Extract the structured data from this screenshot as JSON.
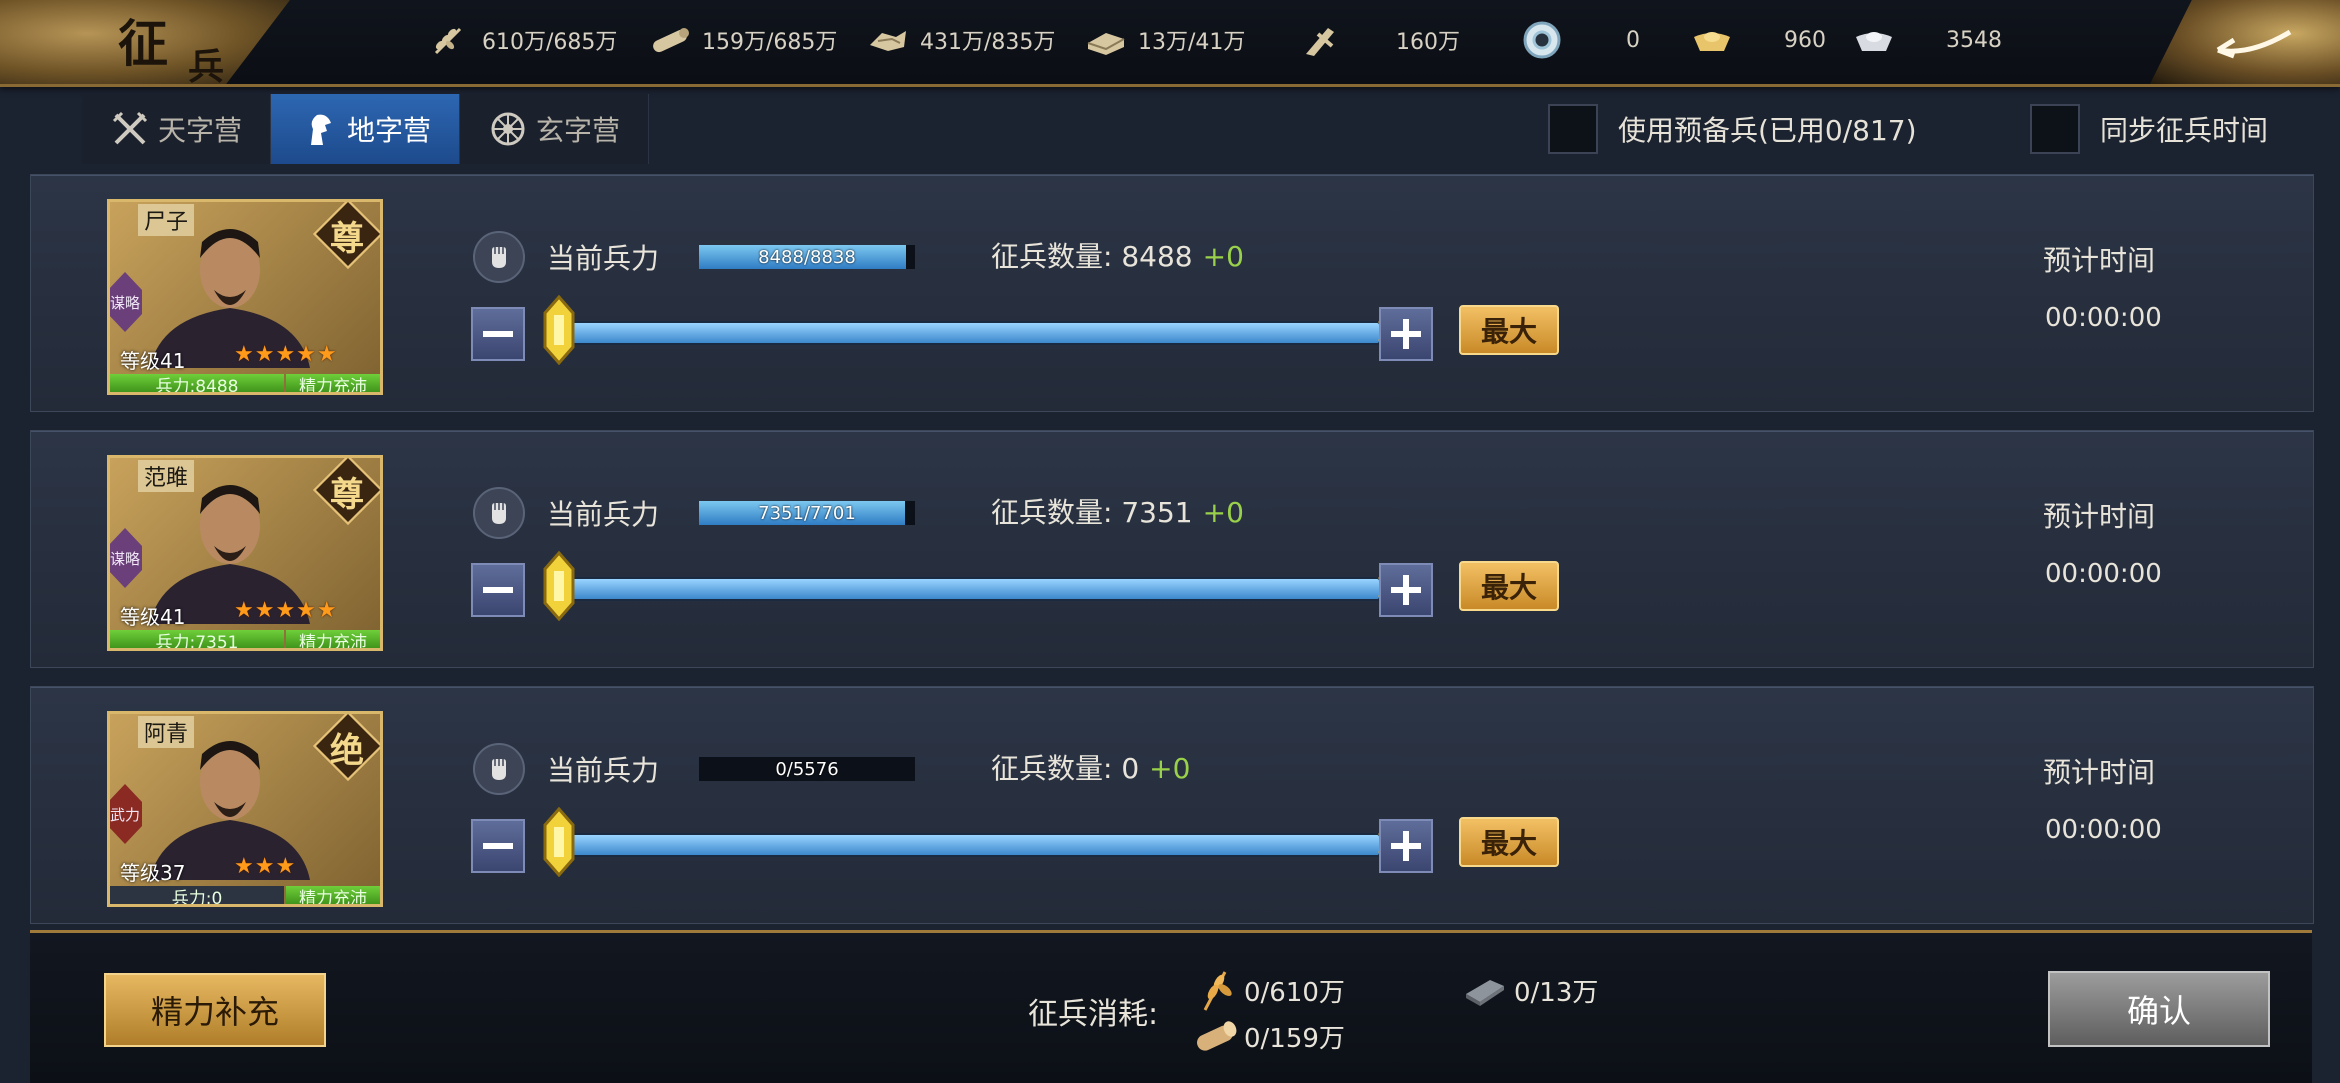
{
  "header": {
    "title_main": "征",
    "title_sub": "兵",
    "resources": [
      {
        "icon": "grain-icon",
        "value": "610万/685万"
      },
      {
        "icon": "wood-icon",
        "value": "159万/685万"
      },
      {
        "icon": "iron-ore-icon",
        "value": "431万/835万"
      },
      {
        "icon": "stone-icon",
        "value": "13万/41万"
      },
      {
        "icon": "copper-coin-icon",
        "value": "160万"
      },
      {
        "icon": "jade-icon",
        "value": "0"
      },
      {
        "icon": "gold-ingot-icon",
        "value": "960"
      },
      {
        "icon": "silver-ingot-icon",
        "value": "3548"
      }
    ]
  },
  "tabs": [
    {
      "label": "天字营",
      "icon": "crossed-swords-icon",
      "active": false
    },
    {
      "label": "地字营",
      "icon": "horse-head-icon",
      "active": true
    },
    {
      "label": "玄字营",
      "icon": "wheel-icon",
      "active": false
    }
  ],
  "options": {
    "reserve_label": "使用预备兵(已用0/817)",
    "reserve_checked": false,
    "sync_label": "同步征兵时间",
    "sync_checked": false
  },
  "labels": {
    "current_troops": "当前兵力",
    "recruit_prefix": "征兵数量: ",
    "estimated_time": "预计时间",
    "max_button": "最大"
  },
  "heroes": [
    {
      "name": "尸子",
      "rank": "尊",
      "tag": "谋略",
      "level": "等级41",
      "stars": "★★★★★",
      "troops_badge": "兵力:8488",
      "energy_badge": "精力充沛",
      "troops_text": "8488/8838",
      "troops_fraction": 0.96,
      "recruit_count": "8488",
      "recruit_delta": "+0",
      "slider_fraction": 1.0,
      "time": "00:00:00"
    },
    {
      "name": "范雎",
      "rank": "尊",
      "tag": "谋略",
      "level": "等级41",
      "stars": "★★★★★",
      "troops_badge": "兵力:7351",
      "energy_badge": "精力充沛",
      "troops_text": "7351/7701",
      "troops_fraction": 0.955,
      "recruit_count": "7351",
      "recruit_delta": "+0",
      "slider_fraction": 1.0,
      "time": "00:00:00"
    },
    {
      "name": "阿青",
      "rank": "绝",
      "tag": "武力",
      "level": "等级37",
      "stars": "★★★",
      "troops_badge": "兵力:0",
      "energy_badge": "精力充沛",
      "troops_text": "0/5576",
      "troops_fraction": 0.0,
      "recruit_count": "0",
      "recruit_delta": "+0",
      "slider_fraction": 1.0,
      "time": "00:00:00"
    }
  ],
  "footer": {
    "refill_button": "精力补充",
    "cost_label": "征兵消耗:",
    "costs": [
      {
        "icon": "grain-icon",
        "value": "0/610万"
      },
      {
        "icon": "wood-icon",
        "value": "0/159万"
      },
      {
        "icon": "iron-icon",
        "value": "0/13万"
      }
    ],
    "confirm_button": "确认"
  },
  "colors": {
    "accent_gold": "#c9a862",
    "tab_active": "#2d67b2",
    "bar_fill": "#4aa0e0",
    "delta_green": "#9ad14a",
    "star_orange": "#ff9a1a"
  }
}
